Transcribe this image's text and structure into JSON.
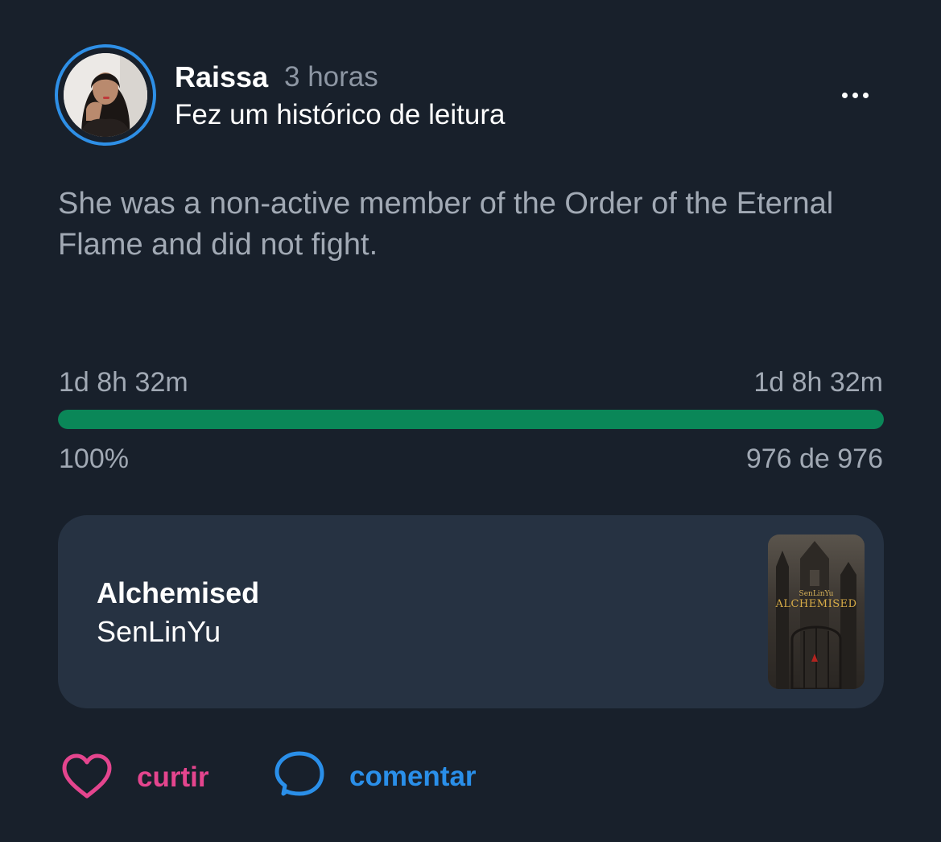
{
  "post": {
    "user_name": "Raissa",
    "time_ago": "3 horas",
    "action": "Fez um histórico de leitura",
    "quote": "She was a non-active member of the Order of the Eternal Flame and did not fight."
  },
  "progress": {
    "time_start": "1d 8h 32m",
    "time_end": "1d 8h 32m",
    "percent_label": "100%",
    "pages_label": "976 de 976",
    "fraction": 1.0
  },
  "book": {
    "title": "Alchemised",
    "author": "SenLinYu",
    "cover_author": "SenLinYu",
    "cover_title": "ALCHEMISED"
  },
  "actions": {
    "like_label": "curtir",
    "comment_label": "comentar"
  },
  "colors": {
    "background": "#18202b",
    "card": "#263242",
    "progress": "#0a8758",
    "like": "#e4458e",
    "comment": "#2a8fe9",
    "avatar_ring": "#2e8fe6"
  },
  "icons": {
    "more": "ellipsis-icon",
    "like": "heart-icon",
    "comment": "speech-bubble-icon"
  }
}
